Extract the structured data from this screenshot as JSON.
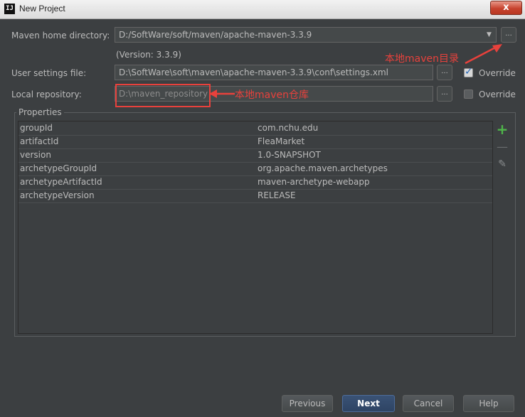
{
  "window": {
    "app_icon": "IJ",
    "title": "New Project",
    "close_label": "x"
  },
  "maven_home": {
    "label": "Maven home directory:",
    "value": "D:/SoftWare/soft/maven/apache-maven-3.3.9",
    "version": "(Version: 3.3.9)",
    "dropdown_icon": "▼",
    "browse_label": "..."
  },
  "user_settings": {
    "label": "User settings file:",
    "value": "D:\\SoftWare\\soft\\maven\\apache-maven-3.3.9\\conf\\settings.xml",
    "browse_label": "...",
    "override_label": "Override",
    "override_checked": true
  },
  "local_repository": {
    "label": "Local repository:",
    "value": "D:\\maven_repository",
    "browse_label": "...",
    "override_label": "Override",
    "override_checked": false
  },
  "annotations": {
    "maven_dir": "本地maven目录",
    "maven_repo": "本地maven仓库",
    "color": "#e8413c"
  },
  "properties": {
    "legend": "Properties",
    "rows": [
      {
        "key": "groupId",
        "value": "com.nchu.edu"
      },
      {
        "key": "artifactId",
        "value": "FleaMarket"
      },
      {
        "key": "version",
        "value": "1.0-SNAPSHOT"
      },
      {
        "key": "archetypeGroupId",
        "value": "org.apache.maven.archetypes"
      },
      {
        "key": "archetypeArtifactId",
        "value": "maven-archetype-webapp"
      },
      {
        "key": "archetypeVersion",
        "value": "RELEASE"
      }
    ],
    "add_icon": "+",
    "remove_icon": "—",
    "edit_icon": "✎"
  },
  "buttons": {
    "previous": "Previous",
    "next": "Next",
    "cancel": "Cancel",
    "help": "Help"
  },
  "colors": {
    "background": "#3c3f41",
    "text": "#bbbbbb",
    "default_button": "#2e4464",
    "add_green": "#4fb54a"
  }
}
